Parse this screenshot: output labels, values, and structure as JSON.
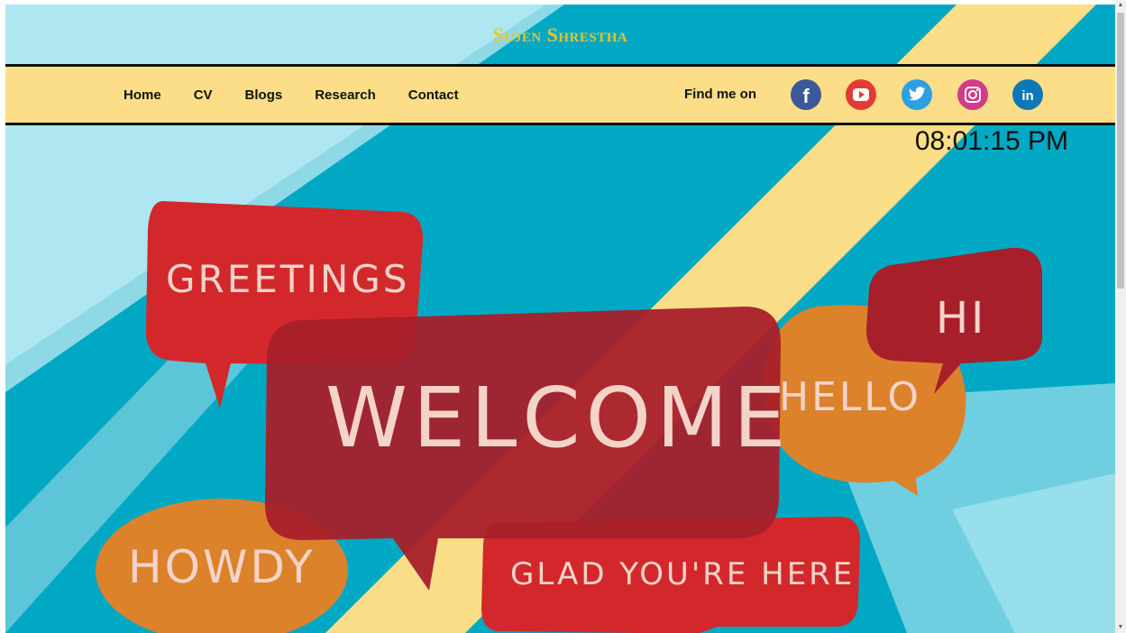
{
  "header": {
    "title": "Sujen Shrestha"
  },
  "nav": {
    "links": [
      "Home",
      "CV",
      "Blogs",
      "Research",
      "Contact"
    ],
    "find_label": "Find me on",
    "social": [
      {
        "icon": "facebook-icon",
        "color": "#3b5998"
      },
      {
        "icon": "youtube-icon",
        "color": "#e43a36"
      },
      {
        "icon": "twitter-icon",
        "color": "#2d9fe3"
      },
      {
        "icon": "instagram-icon",
        "color": "#d23a8a"
      },
      {
        "icon": "linkedin-icon",
        "color": "#0e77b7"
      }
    ]
  },
  "clock": {
    "time": "08:01:15 PM"
  },
  "hero": {
    "bubbles": {
      "greetings": "GREETINGS",
      "welcome": "WELCOME",
      "hello": "HELLO",
      "hi": "HI",
      "howdy": "HOWDY",
      "glad": "GLAD YOU'RE HERE"
    }
  },
  "colors": {
    "teal": "#00a8c4",
    "light_blue": "#aee7f1",
    "yellow_stripe": "#fbde87",
    "red": "#d3282b",
    "dark_red": "#a71f2a",
    "orange": "#dc822a",
    "title_gold": "#e6c62a"
  }
}
